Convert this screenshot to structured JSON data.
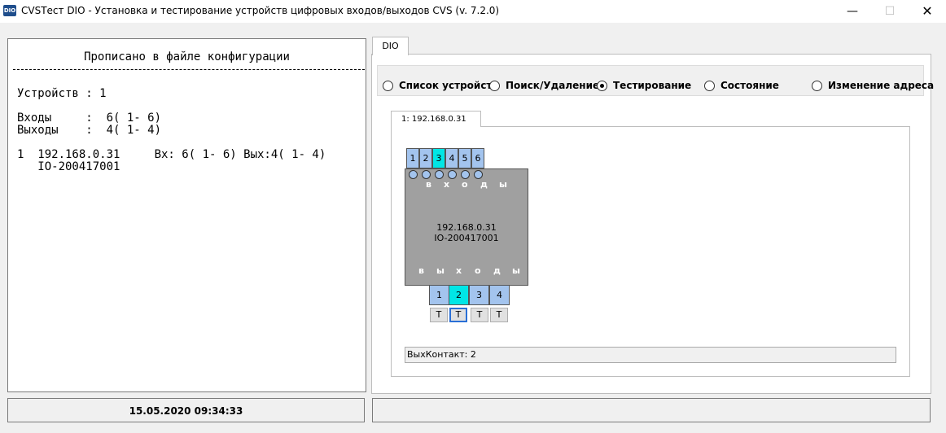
{
  "window": {
    "icon_text": "DIO",
    "title": "CVSTест DIO - Установка и тестирование устройств цифровых входов/выходов  CVS (v. 7.2.0)",
    "min": "—",
    "max": "☐",
    "close": "✕"
  },
  "config": {
    "header": "Прописано в файле конфигурации",
    "devices_line": "Устройств : 1",
    "inputs_line": "Входы     :  6( 1- 6)",
    "outputs_line": "Выходы    :  4( 1- 4)",
    "device_line1": "1  192.168.0.31     Вх: 6( 1- 6) Вых:4( 1- 4)",
    "device_line2": "   IO-200417001"
  },
  "status": {
    "datetime": "15.05.2020    09:34:33"
  },
  "tabs": {
    "dio": "DIO"
  },
  "modes": [
    {
      "label": "Список устройств",
      "selected": false
    },
    {
      "label": "Поиск/Удаление",
      "selected": false
    },
    {
      "label": "Тестирование",
      "selected": true
    },
    {
      "label": "Состояние",
      "selected": false
    },
    {
      "label": "Изменение адреса",
      "selected": false
    }
  ],
  "device_tab": "1:   192.168.0.31",
  "device": {
    "ip": "192.168.0.31",
    "id": "IO-200417001",
    "inputs": [
      {
        "n": "1",
        "active": false
      },
      {
        "n": "2",
        "active": false
      },
      {
        "n": "3",
        "active": true
      },
      {
        "n": "4",
        "active": false
      },
      {
        "n": "5",
        "active": false
      },
      {
        "n": "6",
        "active": false
      }
    ],
    "inputs_word": [
      "в",
      "х",
      "о",
      "д",
      "ы"
    ],
    "outputs_word": [
      "в",
      "ы",
      "х",
      "о",
      "д",
      "ы"
    ],
    "outputs": [
      {
        "n": "1",
        "active": false
      },
      {
        "n": "2",
        "active": true
      },
      {
        "n": "3",
        "active": false
      },
      {
        "n": "4",
        "active": false
      }
    ],
    "test_buttons": [
      "T",
      "T",
      "T",
      "T"
    ],
    "message": "ВыхКонтакт: 2"
  },
  "colors": {
    "active": "#00e6e6",
    "inactive": "#a3c4ee",
    "device_body": "#a0a0a0"
  }
}
